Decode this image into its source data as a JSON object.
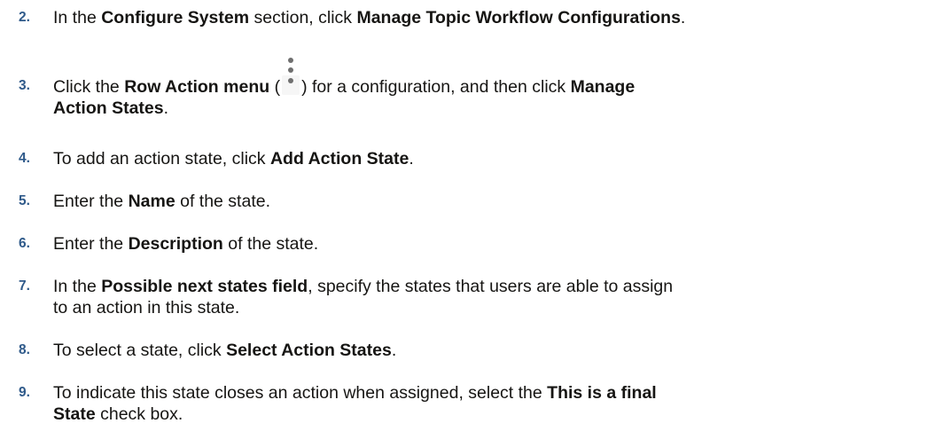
{
  "steps": [
    {
      "num": "2.",
      "parts": [
        "In the ",
        "Configure System",
        " section, click ",
        "Manage Topic Workflow Configurations",
        "."
      ]
    },
    {
      "num": "3.",
      "parts": [
        "Click the ",
        "Row Action menu",
        " (",
        ") for a configuration, and then click ",
        "Manage",
        "Action States",
        "."
      ],
      "icon": "vertical-ellipsis-icon"
    },
    {
      "num": "4.",
      "parts": [
        "To add an action state, click ",
        "Add Action State",
        "."
      ]
    },
    {
      "num": "5.",
      "parts": [
        "Enter the ",
        "Name",
        " of the state."
      ]
    },
    {
      "num": "6.",
      "parts": [
        "Enter the ",
        "Description",
        " of the state."
      ]
    },
    {
      "num": "7.",
      "parts": [
        "In the ",
        "Possible next states field",
        ", specify the states that users are able to assign",
        "to an action in this state."
      ]
    },
    {
      "num": "8.",
      "parts": [
        "To select a state, click ",
        "Select Action States",
        "."
      ]
    },
    {
      "num": "9.",
      "parts": [
        "To indicate this state closes an action when assigned, select the ",
        "This is a final",
        "State",
        " check box."
      ]
    }
  ]
}
